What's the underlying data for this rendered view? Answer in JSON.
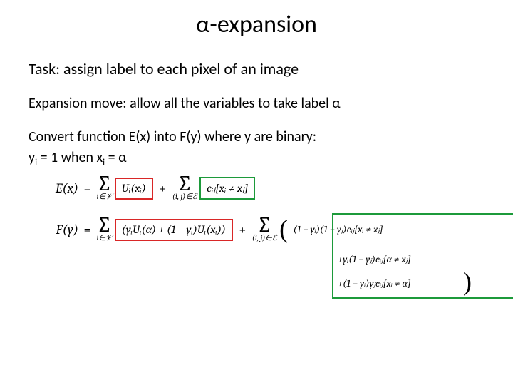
{
  "title": "α-expansion",
  "task_line": "Task: assign label to each pixel of an image",
  "expansion_line": "Expansion move: allow all the variables to take label α",
  "convert_line": "Convert function E(x) into F(y) where y are binary:",
  "binary_def_pre": "y",
  "binary_def_isub": "i",
  "binary_def_mid": " = 1  when x",
  "binary_def_isub2": "i",
  "binary_def_post": " = α",
  "eq": {
    "Ex_label": "E(x)",
    "Fy_label": "F(y)",
    "equals": "=",
    "plus": "+",
    "sum_sigma": "∑",
    "sum_iV": "i∈𝒱",
    "sum_ijE": "(i, j)∈ℰ",
    "Ui_xi": "Uᵢ(xᵢ)",
    "cij_bracket": "cᵢⱼ[xᵢ ≠ xⱼ]",
    "fy_unary": "(yᵢUᵢ(α) + (1 − yᵢ)Uᵢ(xᵢ))",
    "fy_pair_line1": "(1 − yᵢ)(1 − yⱼ)cᵢⱼ[xᵢ ≠ xⱼ]",
    "fy_pair_line2": "+yᵢ(1 − yⱼ)cᵢⱼ[α ≠ xⱼ]",
    "fy_pair_line3": "+(1 − yᵢ)yⱼcᵢⱼ[xᵢ ≠ α]",
    "big_lparen": "(",
    "big_rparen": ")"
  }
}
